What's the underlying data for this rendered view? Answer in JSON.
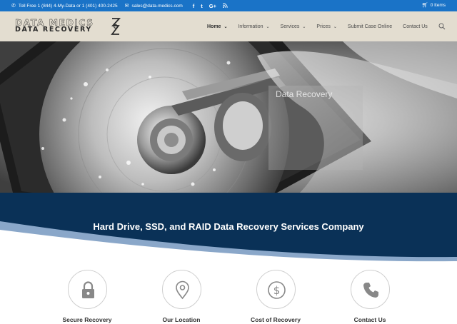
{
  "topbar": {
    "phone": "Toll Free 1 (844) 4-My-Data or 1 (401) 400-2425",
    "email": "sales@data-medics.com",
    "cart": "0 Items",
    "social": [
      "f",
      "t",
      "G+",
      "rss"
    ]
  },
  "header": {
    "logo_line1": "DATA MEDICS",
    "logo_line2": "DATA RECOVERY",
    "nav": [
      {
        "label": "Home",
        "has_dropdown": true,
        "active": true
      },
      {
        "label": "Information",
        "has_dropdown": true,
        "active": false
      },
      {
        "label": "Services",
        "has_dropdown": true,
        "active": false
      },
      {
        "label": "Prices",
        "has_dropdown": true,
        "active": false
      },
      {
        "label": "Submit Case Online",
        "has_dropdown": false,
        "active": false
      },
      {
        "label": "Contact Us",
        "has_dropdown": false,
        "active": false
      }
    ]
  },
  "hero": {
    "caption_title": "Data Recovery"
  },
  "banner": {
    "title": "Hard Drive, SSD, and RAID Data Recovery Services Company"
  },
  "features": [
    {
      "label": "Secure Recovery",
      "icon": "lock-icon"
    },
    {
      "label": "Our Location",
      "icon": "location-pin-icon"
    },
    {
      "label": "Cost of Recovery",
      "icon": "dollar-icon"
    },
    {
      "label": "Contact Us",
      "icon": "phone-icon"
    }
  ],
  "colors": {
    "topbar": "#1a73c7",
    "header_bg": "#e3ddd0",
    "banner_bg": "#0a3157",
    "banner_wave": "#8aa7c9"
  }
}
